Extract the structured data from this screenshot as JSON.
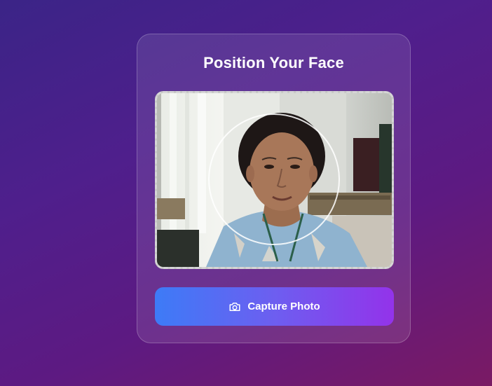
{
  "card": {
    "title": "Position Your Face"
  },
  "camera": {
    "face_guide": "circle"
  },
  "capture_button": {
    "label": "Capture Photo",
    "icon": "camera-icon"
  },
  "colors": {
    "button_gradient_start": "#3d7bf7",
    "button_gradient_end": "#9333ea",
    "background_start": "#3b2487",
    "background_end": "#7a1a64"
  }
}
